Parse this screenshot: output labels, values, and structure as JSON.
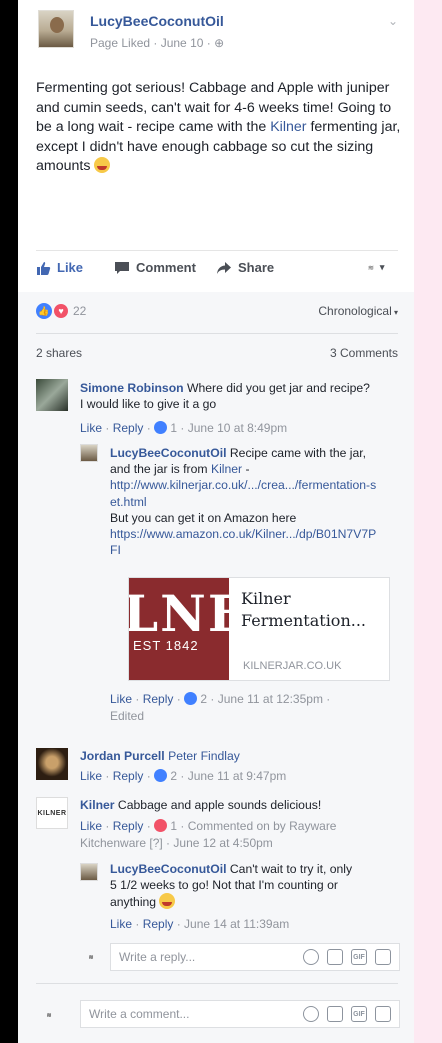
{
  "post": {
    "page_name": "LucyBeeCoconutOil",
    "meta": "Page Liked · June 10 · ",
    "text_1": "Fermenting got serious! Cabbage and Apple with juniper and cumin seeds, can't wait for 4-6 weeks time! Going to be a long wait - recipe came with the ",
    "text_link": "Kilner",
    "text_2": " fermenting jar, except I didn't have enough cabbage so cut the sizing amounts "
  },
  "actions": {
    "like": "Like",
    "comment": "Comment",
    "share": "Share"
  },
  "reactions": {
    "count": "22",
    "sort_label": "Chronological"
  },
  "stats": {
    "shares": "2 shares",
    "comments": "3 Comments"
  },
  "comments": [
    {
      "author": "Simone Robinson",
      "text": " Where did you get jar and recipe? I would like to give it a go",
      "like": "Like",
      "reply": "Reply",
      "likes": "1",
      "time": "June 10 at 8:49pm"
    },
    {
      "author": "Jordan Purcell",
      "mention": "Peter Findlay",
      "like": "Like",
      "reply": "Reply",
      "likes": "2",
      "time": "June 11 at 9:47pm"
    },
    {
      "author": "Kilner",
      "text": " Cabbage and apple sounds delicious!",
      "like": "Like",
      "reply": "Reply",
      "likes": "1",
      "commented_by": "Commented on by Rayware Kitchenware [?]",
      "time": "June 12 at 4:50pm"
    }
  ],
  "reply_1": {
    "author": "LucyBeeCoconutOil",
    "text_a": " Recipe came with the jar, and the jar is from ",
    "link_kilner": "Kilner",
    "text_b": " -",
    "url_1": "http://www.kilnerjar.co.uk/.../crea.../fermentation-set.html",
    "text_c": "But you can get it on Amazon here",
    "url_2": "https://www.amazon.co.uk/Kilner.../dp/B01N7V7PFI",
    "like": "Like",
    "reply": "Reply",
    "likes": "2",
    "time": "June 11 at 12:35pm",
    "edited": "Edited"
  },
  "link_preview": {
    "image_big": "LNE",
    "image_est": "EST 1842",
    "title": "Kilner Fermentation...",
    "domain": "KILNERJAR.CO.UK"
  },
  "reply_2": {
    "author": "LucyBeeCoconutOil",
    "text": " Can't wait to try it, only 5 1/2 weeks to go! Not that I'm counting or anything ",
    "like": "Like",
    "reply": "Reply",
    "time": "June 14 at 11:39am"
  },
  "inputs": {
    "reply_placeholder": "Write a reply...",
    "comment_placeholder": "Write a comment...",
    "gif_label": "GIF",
    "kilner_logo": "KILNER"
  },
  "colors": {
    "link": "#365899",
    "like_blue": "#4080ff",
    "love_red": "#f25268",
    "side": "#000000",
    "right_band": "#fde9f2"
  }
}
